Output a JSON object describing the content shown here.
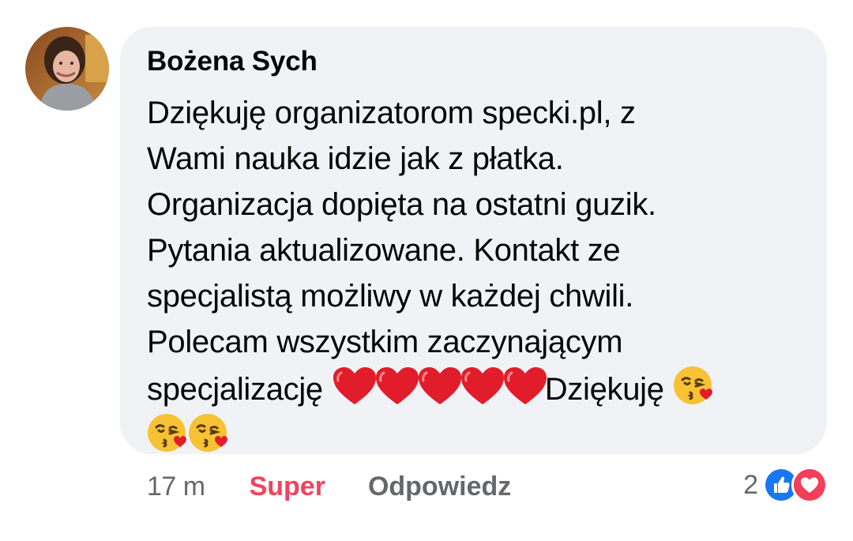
{
  "comment": {
    "author": "Bożena Sych",
    "lines": [
      "Dziękuję organizatorom specki.pl, z",
      "Wami nauka idzie jak z płatka.",
      "Organizacja dopięta na ostatni guzik.",
      "Pytania aktualizowane. Kontakt ze",
      "specjalistą możliwy w każdej chwili.",
      "Polecam wszystkim zaczynającym"
    ],
    "line7_text_a": "specjalizację ",
    "line7_text_b": "Dziękuję ",
    "emojis": {
      "heart": "red-heart-icon",
      "kiss": "face-blowing-kiss-icon"
    }
  },
  "actions": {
    "time": "17 m",
    "like_label": "Super",
    "reply_label": "Odpowiedz"
  },
  "reactions": {
    "count": "2",
    "icons": [
      "thumbs-up-icon",
      "heart-icon"
    ]
  },
  "colors": {
    "bubble": "#f0f2f5",
    "like_active": "#f3425f",
    "secondary_text": "#65676b",
    "like_blue": "#1877f2",
    "love_red": "#f33e58"
  }
}
